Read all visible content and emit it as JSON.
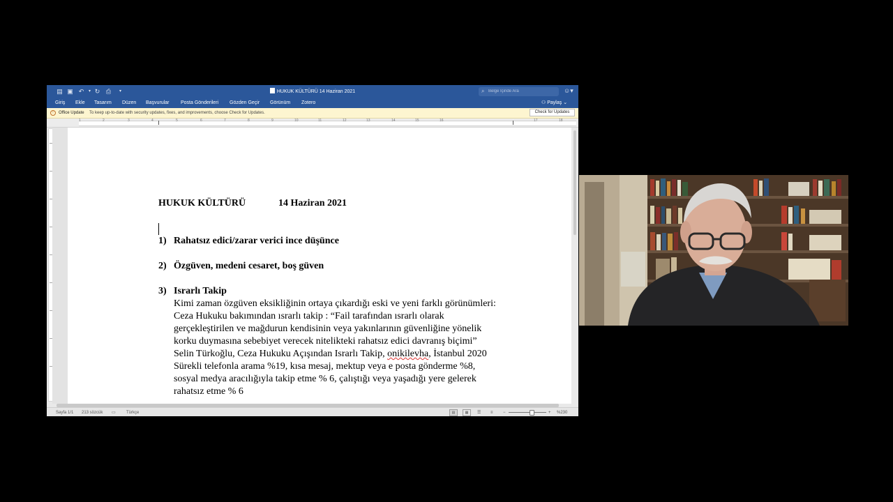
{
  "window": {
    "doc_title": "HUKUK KÜLTÜRÜ  14 Haziran 2021",
    "search_placeholder": "Belge İçinde Ara",
    "share_label": "Paylaş",
    "qa_icons": [
      "sidebar-icon",
      "save-icon",
      "undo-icon",
      "redo-icon",
      "print-icon",
      "customize-icon"
    ]
  },
  "ribbon": {
    "tabs": [
      "Giriş",
      "Ekle",
      "Tasarım",
      "Düzen",
      "Başvurular",
      "Posta Gönderileri",
      "Gözden Geçir",
      "Görünüm",
      "Zotero"
    ]
  },
  "update_bar": {
    "title": "Office Update",
    "message": "To keep up-to-date with security updates, fixes, and improvements, choose Check for Updates.",
    "button": "Check for Updates"
  },
  "ruler": {
    "numbers": [
      "1",
      "2",
      "3",
      "4",
      "5",
      "6",
      "7",
      "8",
      "9",
      "10",
      "11",
      "12",
      "13",
      "14",
      "15",
      "16",
      "17",
      "18"
    ]
  },
  "document": {
    "heading_title": "HUKUK KÜLTÜRÜ",
    "heading_date": "14 Haziran 2021",
    "items": [
      {
        "num": "1)",
        "title": "Rahatsız edici/zarar verici ince düşünce"
      },
      {
        "num": "2)",
        "title": "Özgüven, medeni cesaret, boş güven"
      },
      {
        "num": "3)",
        "title": "Israrlı Takip"
      }
    ],
    "item3_lines": [
      "Kimi zaman özgüven eksikliğinin ortaya çıkardığı eski ve yeni farklı görünümleri:",
      "Ceza Hukuku bakımından ısrarlı takip : “Fail tarafından ısrarlı olarak",
      "gerçekleştirilen ve mağdurun kendisinin veya yakınlarının güvenliğine yönelik",
      "korku duymasına sebebiyet verecek nitelikteki rahatsız edici davranış biçimi”",
      "Selin Türkoğlu, Ceza Hukuku Açışından Israrlı Takip, ",
      "Sürekli telefonla arama %19, kısa mesaj, mektup veya e posta gönderme %8,",
      "sosyal medya aracılığıyla takip etme % 6, çalıştığı veya yaşadığı yere gelerek",
      "rahatsız etme % 6"
    ],
    "publisher": "onikilevha",
    "line5_tail": ", İstanbul 2020"
  },
  "status": {
    "page": "Sayfa 1/1",
    "words": "213 sözcük",
    "language": "Türkçe",
    "zoom": "%230",
    "zoom_percent": 230
  },
  "colors": {
    "title_bar": "#2b579a",
    "update_bar": "#fdf5d0",
    "background": "#000000"
  }
}
